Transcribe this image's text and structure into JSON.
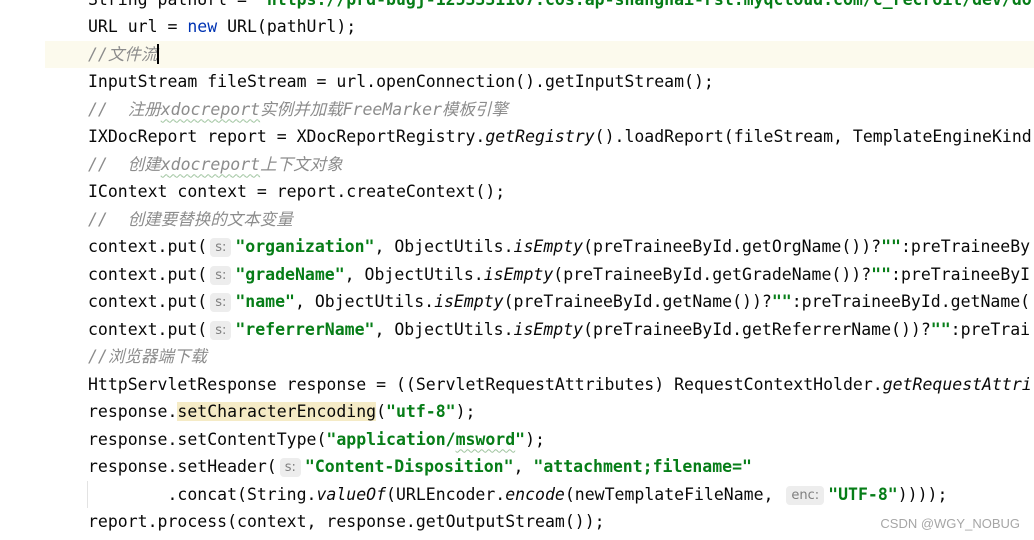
{
  "colors": {
    "background": "#ffffff",
    "text": "#080808",
    "keyword": "#0033B3",
    "string": "#067D17",
    "comment": "#8C8C8C",
    "hint_bg": "#EDEDED",
    "hint_fg": "#7F7F7F",
    "current_line": "#FCFAED",
    "usage_highlight": "#F5EBC6",
    "typo_underline": "#9FC49F",
    "watermark": "#A6A6A6",
    "indent_guide": "#E3E3E3",
    "caret": "#000000"
  },
  "editor": {
    "lines": [
      {
        "tokens": [
          {
            "text": "String pathUrl = "
          },
          {
            "text": "\"https://prd-bugj-1253331107.cos.ap-shanghai-rsl.myqcloud.com/c_recroit/dev/do",
            "string": true
          }
        ]
      },
      {
        "tokens": [
          {
            "text": "URL url = "
          },
          {
            "text": "new",
            "keyword": true
          },
          {
            "text": " URL(pathUrl);"
          }
        ]
      },
      {
        "current": true,
        "caret": true,
        "tokens": [
          {
            "text": "//文件流",
            "comment": true
          }
        ]
      },
      {
        "tokens": [
          {
            "text": "InputStream fileStream = url.openConnection().getInputStream();"
          }
        ]
      },
      {
        "tokens": [
          {
            "text": "//  注册",
            "comment": true
          },
          {
            "text": "xdocreport",
            "comment": true,
            "typo": true
          },
          {
            "text": "实例并加载FreeMarker模板引擎",
            "comment": true
          }
        ]
      },
      {
        "tokens": [
          {
            "text": "IXDocReport report = XDocReportRegistry."
          },
          {
            "text": "getRegistry",
            "static_call": true
          },
          {
            "text": "().loadReport(fileStream, TemplateEngineKind"
          }
        ]
      },
      {
        "tokens": [
          {
            "text": "//  创建",
            "comment": true
          },
          {
            "text": "xdocreport",
            "comment": true,
            "typo": true
          },
          {
            "text": "上下文对象",
            "comment": true
          }
        ]
      },
      {
        "tokens": [
          {
            "text": "IContext context = report.createContext();"
          }
        ]
      },
      {
        "tokens": [
          {
            "text": "//  创建要替换的文本变量",
            "comment": true
          }
        ]
      },
      {
        "tokens": [
          {
            "text": "context.put("
          },
          {
            "text": "s:",
            "hint": true
          },
          {
            "text": "\"organization\"",
            "string": true
          },
          {
            "text": ", ObjectUtils."
          },
          {
            "text": "isEmpty",
            "static_call": true
          },
          {
            "text": "(preTraineeById.getOrgName())?"
          },
          {
            "text": "\"\"",
            "string": true
          },
          {
            "text": ":preTraineeBy"
          }
        ]
      },
      {
        "tokens": [
          {
            "text": "context.put("
          },
          {
            "text": "s:",
            "hint": true
          },
          {
            "text": "\"gradeName\"",
            "string": true
          },
          {
            "text": ", ObjectUtils."
          },
          {
            "text": "isEmpty",
            "static_call": true
          },
          {
            "text": "(preTraineeById.getGradeName())?"
          },
          {
            "text": "\"\"",
            "string": true
          },
          {
            "text": ":preTraineeByI"
          }
        ]
      },
      {
        "tokens": [
          {
            "text": "context.put("
          },
          {
            "text": "s:",
            "hint": true
          },
          {
            "text": "\"name\"",
            "string": true
          },
          {
            "text": ", ObjectUtils."
          },
          {
            "text": "isEmpty",
            "static_call": true
          },
          {
            "text": "(preTraineeById.getName())?"
          },
          {
            "text": "\"\"",
            "string": true
          },
          {
            "text": ":preTraineeById.getName("
          }
        ]
      },
      {
        "tokens": [
          {
            "text": "context.put("
          },
          {
            "text": "s:",
            "hint": true
          },
          {
            "text": "\"referrerName\"",
            "string": true
          },
          {
            "text": ", ObjectUtils."
          },
          {
            "text": "isEmpty",
            "static_call": true
          },
          {
            "text": "(preTraineeById.getReferrerName())?"
          },
          {
            "text": "\"\"",
            "string": true
          },
          {
            "text": ":preTrai"
          }
        ]
      },
      {
        "tokens": [
          {
            "text": "//浏览器端下载",
            "comment": true
          }
        ]
      },
      {
        "tokens": [
          {
            "text": "HttpServletResponse response = ((ServletRequestAttributes) RequestContextHolder."
          },
          {
            "text": "getRequestAttri",
            "static_call": true
          }
        ]
      },
      {
        "tokens": [
          {
            "text": "response."
          },
          {
            "text": "setCharacterEncoding",
            "usage_highlight": true
          },
          {
            "text": "("
          },
          {
            "text": "\"utf-8\"",
            "string": true
          },
          {
            "text": ");"
          }
        ]
      },
      {
        "tokens": [
          {
            "text": "response.setContentType("
          },
          {
            "text": "\"application/",
            "string": true
          },
          {
            "text": "msword",
            "string": true,
            "typo": true
          },
          {
            "text": "\"",
            "string": true
          },
          {
            "text": ");"
          }
        ]
      },
      {
        "tokens": [
          {
            "text": "response.setHeader("
          },
          {
            "text": "s:",
            "hint": true
          },
          {
            "text": "\"Content-Disposition\"",
            "string": true
          },
          {
            "text": ", "
          },
          {
            "text": "\"attachment;filename=\"",
            "string": true
          }
        ]
      },
      {
        "tokens": [
          {
            "text": "        .concat(String."
          },
          {
            "text": "valueOf",
            "static_call": true
          },
          {
            "text": "(URLEncoder."
          },
          {
            "text": "encode",
            "static_call": true
          },
          {
            "text": "(newTemplateFileName, "
          },
          {
            "text": "enc:",
            "hint": true
          },
          {
            "text": "\"UTF-8\"",
            "string": true
          },
          {
            "text": "))));"
          }
        ]
      },
      {
        "tokens": [
          {
            "text": "report.process(context, response.getOutputStream());"
          }
        ]
      }
    ]
  },
  "watermark": "CSDN @WGY_NOBUG"
}
